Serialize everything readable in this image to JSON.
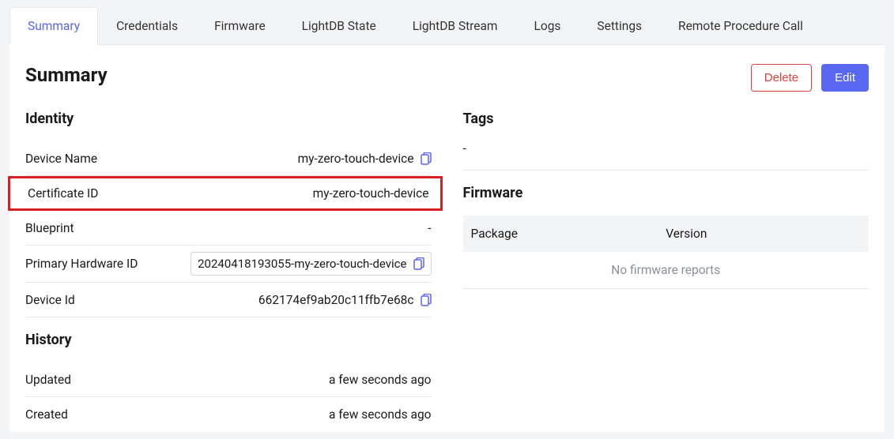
{
  "tabs": [
    {
      "label": "Summary",
      "active": true
    },
    {
      "label": "Credentials",
      "active": false
    },
    {
      "label": "Firmware",
      "active": false
    },
    {
      "label": "LightDB State",
      "active": false
    },
    {
      "label": "LightDB Stream",
      "active": false
    },
    {
      "label": "Logs",
      "active": false
    },
    {
      "label": "Settings",
      "active": false
    },
    {
      "label": "Remote Procedure Call",
      "active": false
    }
  ],
  "page_title": "Summary",
  "actions": {
    "delete_label": "Delete",
    "edit_label": "Edit"
  },
  "identity": {
    "title": "Identity",
    "device_name": {
      "label": "Device Name",
      "value": "my-zero-touch-device",
      "copyable": true,
      "highlighted": false
    },
    "certificate_id": {
      "label": "Certificate ID",
      "value": "my-zero-touch-device",
      "copyable": false,
      "highlighted": true
    },
    "blueprint": {
      "label": "Blueprint",
      "value": "-",
      "copyable": false,
      "highlighted": false
    },
    "primary_hardware_id": {
      "label": "Primary Hardware ID",
      "value": "20240418193055-my-zero-touch-device",
      "copyable": true,
      "chip": true,
      "highlighted": false
    },
    "device_id": {
      "label": "Device Id",
      "value": "662174ef9ab20c11ffb7e68c",
      "copyable": true,
      "highlighted": false
    }
  },
  "history": {
    "title": "History",
    "updated": {
      "label": "Updated",
      "value": "a few seconds ago"
    },
    "created": {
      "label": "Created",
      "value": "a few seconds ago"
    }
  },
  "tags": {
    "title": "Tags",
    "value": "-"
  },
  "firmware": {
    "title": "Firmware",
    "col_package": "Package",
    "col_version": "Version",
    "empty_text": "No firmware reports"
  }
}
